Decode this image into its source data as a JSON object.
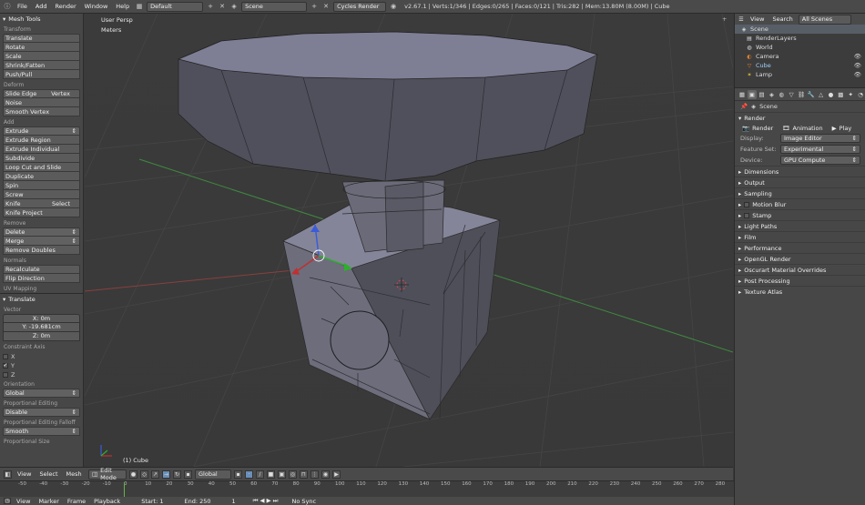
{
  "topbar": {
    "menus": [
      "File",
      "Add",
      "Render",
      "Window",
      "Help"
    ],
    "screen_layout": "Default",
    "scene": "Scene",
    "render_engine": "Cycles Render",
    "stats": "v2.67.1 | Verts:1/346 | Edges:0/265 | Faces:0/121 | Tris:282 | Mem:13.80M (8.00M) | Cube"
  },
  "toolshelf": {
    "title": "Mesh Tools",
    "transform": {
      "label": "Transform",
      "buttons": [
        "Translate",
        "Rotate",
        "Scale",
        "Shrink/Fatten",
        "Push/Pull"
      ]
    },
    "deform": {
      "label": "Deform",
      "slide_edge": "Slide Edge",
      "vertex": "Vertex",
      "buttons": [
        "Noise",
        "Smooth Vertex"
      ]
    },
    "add": {
      "label": "Add",
      "extrude": "Extrude",
      "buttons": [
        "Extrude Region",
        "Extrude Individual",
        "Subdivide",
        "Loop Cut and Slide",
        "Duplicate",
        "Spin",
        "Screw"
      ],
      "knife": "Knife",
      "select": "Select",
      "knife_project": "Knife Project"
    },
    "remove": {
      "label": "Remove",
      "delete": "Delete",
      "merge": "Merge",
      "remove_doubles": "Remove Doubles"
    },
    "normals": {
      "label": "Normals",
      "buttons": [
        "Recalculate",
        "Flip Direction"
      ]
    },
    "uv_mapping": "UV Mapping",
    "operator": {
      "title": "Translate",
      "vector_label": "Vector",
      "x": "X: 0m",
      "y": "Y: -19.681cm",
      "z": "Z: 0m",
      "constraint_label": "Constraint Axis",
      "axes": [
        "X",
        "Y",
        "Z"
      ],
      "orientation_label": "Orientation",
      "orientation": "Global",
      "prop_edit_label": "Proportional Editing",
      "prop_edit": "Disable",
      "falloff_label": "Proportional Editing Falloff",
      "falloff": "Smooth",
      "prop_size_label": "Proportional Size"
    }
  },
  "viewport": {
    "view_name": "User Persp",
    "units": "Meters",
    "object_label": "(1) Cube"
  },
  "view3d_header": {
    "menus": [
      "View",
      "Select",
      "Mesh"
    ],
    "mode": "Edit Mode",
    "orientation": "Global"
  },
  "timeline": {
    "ticks": [
      "-50",
      "-40",
      "-30",
      "-20",
      "-10",
      "0",
      "10",
      "20",
      "30",
      "40",
      "50",
      "60",
      "70",
      "80",
      "90",
      "100",
      "110",
      "120",
      "130",
      "140",
      "150",
      "160",
      "170",
      "180",
      "190",
      "200",
      "210",
      "220",
      "230",
      "240",
      "250",
      "260",
      "270",
      "280"
    ],
    "menus": [
      "View",
      "Marker",
      "Frame",
      "Playback"
    ],
    "start": "Start: 1",
    "end": "End: 250",
    "current": "1",
    "sync": "No Sync"
  },
  "outliner": {
    "menus": [
      "View",
      "Search"
    ],
    "filter": "All Scenes",
    "items": [
      {
        "label": "Scene",
        "icon": "scene-icon"
      },
      {
        "label": "RenderLayers",
        "icon": "renderlayers-icon"
      },
      {
        "label": "World",
        "icon": "world-icon"
      },
      {
        "label": "Camera",
        "icon": "camera-icon"
      },
      {
        "label": "Cube",
        "icon": "mesh-icon"
      },
      {
        "label": "Lamp",
        "icon": "lamp-icon"
      }
    ]
  },
  "properties": {
    "breadcrumb": "Scene",
    "panel": "Render",
    "render_btn": "Render",
    "animation_btn": "Animation",
    "play_btn": "Play",
    "display_label": "Display:",
    "display": "Image Editor",
    "feature_label": "Feature Set:",
    "feature": "Experimental",
    "device_label": "Device:",
    "device": "GPU Compute",
    "sections": [
      "Dimensions",
      "Output",
      "Sampling",
      "Motion Blur",
      "Stamp",
      "Light Paths",
      "Film",
      "Performance",
      "OpenGL Render",
      "Oscurart Material Overrides",
      "Post Processing",
      "Texture Atlas"
    ]
  }
}
